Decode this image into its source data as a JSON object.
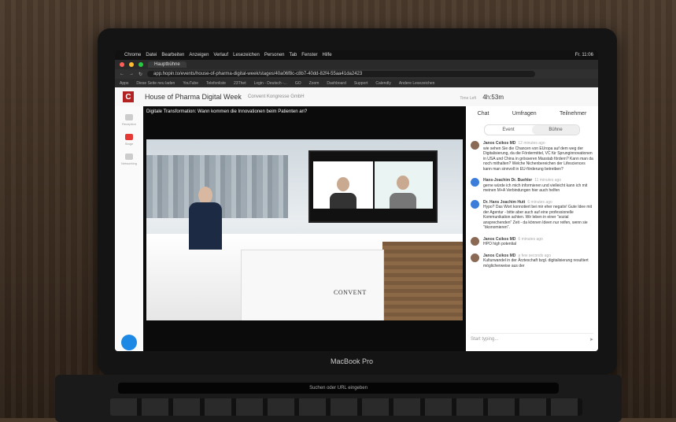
{
  "mac_menu": {
    "items": [
      "Chrome",
      "Datei",
      "Bearbeiten",
      "Anzeigen",
      "Verlauf",
      "Lesezeichen",
      "Personen",
      "Tab",
      "Fenster",
      "Hilfe"
    ],
    "status_right": "Fr. 11:06"
  },
  "browser": {
    "tab_title": "Hauptbühne",
    "url": "app.hopin.to/events/house-of-pharma-digital-week/stages/40a06f8c-c8b7-40dd-82f4-55aa41da2423",
    "bookmarks": [
      "Apps",
      "Diese Seite neu laden",
      "YouTube",
      "Telefonliste",
      "23Thet",
      "Login - Deutsch -...",
      "GO",
      "Zoom",
      "Dashboard",
      "Support",
      "Calendly",
      "Andere Lesezeichen"
    ]
  },
  "app": {
    "logo_letter": "C",
    "event_title": "House of Pharma Digital Week",
    "organizer": "Convent Kongresse GmbH",
    "time_left_label": "Time Left",
    "time_left": "4h:53m",
    "left_nav": [
      "Reception",
      "Stage",
      "Networking"
    ]
  },
  "stage": {
    "title": "Digitale Transformation: Wann kommen die Innovationen beim Patienten an?",
    "desk_brand": "CONVENT"
  },
  "sidebar": {
    "tabs": [
      "Chat",
      "Umfragen",
      "Teilnehmer"
    ],
    "segment": [
      "Event",
      "Bühne"
    ],
    "messages": [
      {
        "name": "Janos Csikos MD",
        "time": "12 minutes ago",
        "text": "wie sehen Sie die Chancen von EUropa auf dem weg der Digitalisierung, da die Fördermittel, VC für Sprunginnovationen in USA und China in grösseren Masstab fördern? Kann man da noch mithalten? Welche Nichenbereichen der Lifesciences kann man sinnvoll in EU-förderung betreiben?",
        "avatar_color": "#8a6a55"
      },
      {
        "name": "Hans-Joachim Dr. Buehler",
        "time": "11 minutes ago",
        "text": "gerne würde ich mich informieren und vielleicht kann ich mit meinen M+A Verbindungen hier auch helfen",
        "avatar_color": "#3b7dd8"
      },
      {
        "name": "Dr. Hans Joachim Hutt",
        "time": "6 minutes ago",
        "text": "Hypo? Das Wort konnotiert bei mir eher negativ! Gute Idee mit der Agentur - bitte aber auch auf eine professionelle Kommunikation achten. Wir leben in einer \"sozial ansprechenden\" Zeit - da können Ideen nur reifen, wenn sie \"ökonomieren\".",
        "avatar_color": "#3b7dd8"
      },
      {
        "name": "Janos Csikos MD",
        "time": "6 minutes ago",
        "text": "HPO high potential",
        "avatar_color": "#8a6a55"
      },
      {
        "name": "Janos Csikos MD",
        "time": "a few seconds ago",
        "text": "Kulturwandel in der Ärzteschaft bzgl. digitalisierung resultiert möglicherweise aus der",
        "avatar_color": "#8a6a55"
      }
    ],
    "compose_placeholder": "Start typing..."
  },
  "device": {
    "label": "MacBook Pro",
    "touchbar_text": "Suchen oder URL eingeben"
  }
}
